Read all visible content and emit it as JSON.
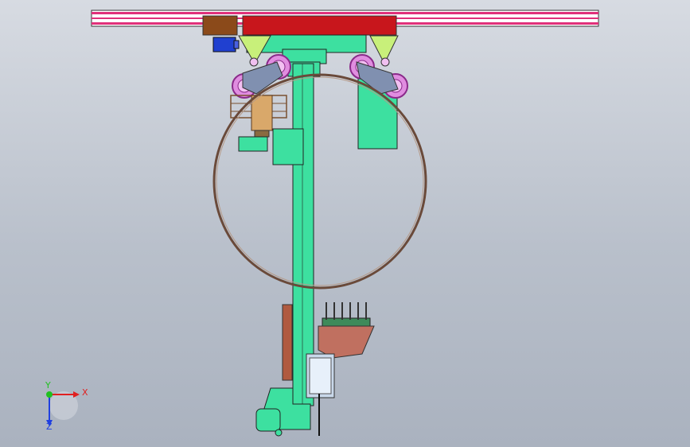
{
  "viewport": {
    "background_top": "#d7dbe2",
    "background_bottom": "#aab2bf"
  },
  "triad": {
    "x_label": "X",
    "y_label": "Y",
    "z_label": "Z",
    "x_color": "#e02020",
    "y_color": "#20c020",
    "z_color": "#2040e0"
  },
  "model": {
    "rail_color": "#e0307a",
    "carriage_color": "#c8161c",
    "motor_block_color": "#8b4a1a",
    "body_color": "#3de0a0",
    "bracket_color": "#c8f07a",
    "roller_color": "#c070c0",
    "link_color": "#8090b0",
    "pipe_ring_color": "#6a4a3a",
    "torch_color": "#c0a070",
    "clamp_color": "#c07060",
    "blue_motor_color": "#2040d0"
  }
}
